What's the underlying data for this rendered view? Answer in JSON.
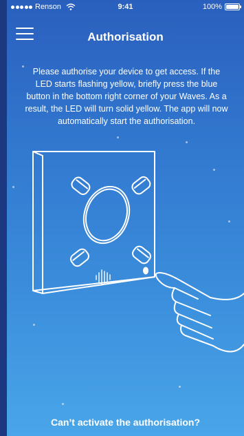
{
  "status_bar": {
    "carrier": "Renson",
    "time": "9:41",
    "battery": "100%"
  },
  "header": {
    "title": "Authorisation",
    "menu_icon": "hamburger-menu-icon"
  },
  "main": {
    "instructions": "Please authorise your device to get access. If the LED starts flashing yellow, briefly press the blue button in the bottom right corner of your Waves. As a result, the LED will turn solid yellow. The app will now automatically start the authorisation.",
    "illustration_icon": "waves-device-press-button-illustration"
  },
  "footer": {
    "help_link": "Can’t activate the authorisation?"
  },
  "colors": {
    "gradient_top": "#2a5fbd",
    "gradient_bottom": "#4aa6e8",
    "frame": "#1c3880",
    "text": "#ffffff"
  }
}
